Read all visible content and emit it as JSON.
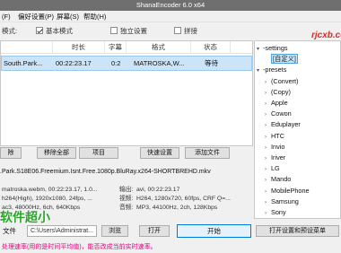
{
  "window": {
    "title": "ShanaEncoder 6.0 x64"
  },
  "menu": {
    "items": [
      "(F)",
      "偏好设置(P)",
      "屏幕(S)",
      "帮助(H)"
    ]
  },
  "options": {
    "mode_label": "模式:",
    "basic_mode": "基本模式",
    "independent": "独立设置",
    "concat": "拼接"
  },
  "filelist": {
    "columns": [
      "",
      "时长",
      "字幕",
      "格式",
      "状态"
    ],
    "rows": [
      {
        "name": "South.Park...",
        "duration": "00:22:23.17",
        "subtitle": "0:2",
        "format": "MATROSKA,W...",
        "status": "等待"
      }
    ]
  },
  "buttons": [
    "除",
    "移除全部",
    "项目",
    "快速设置",
    "添加文件"
  ],
  "details": {
    "path": ".Park.S18E06.Freemium.Isnt.Free.1080p.BluRay.x264-SHORTBREHD.mkv",
    "in1": "matroska.webm, 00:22:23.17, 1.0...",
    "in2": "h264(High), 1920x1080, 24fps, ...",
    "in3": "ac3, 48000Hz, 6ch, 640Kbps",
    "out1_label": "输出:",
    "out1": "avi, 00:22:23.17",
    "out2_label": "视频:",
    "out2": "H264, 1280x720, 60fps, CRF Q=...",
    "out3_label": "音频:",
    "out3": "MP3, 44100Hz, 2ch, 128Kbps"
  },
  "output": {
    "label": "文件",
    "path": "C:\\Users\\Administrat...",
    "browse": "浏览",
    "open": "打开",
    "start": "开始",
    "open_settings": "打开设置和预设菜单"
  },
  "status": "处理速率(用的是时间平均值)，能否改成当前实时速率。",
  "presets": {
    "nodes": [
      {
        "text": "-settings",
        "tw": "▾",
        "indent": 0
      },
      {
        "text": "[自定义]",
        "tw": "",
        "indent": 1,
        "selected": true
      },
      {
        "text": "-presets",
        "tw": "▾",
        "indent": 0
      },
      {
        "text": "(Convert)",
        "tw": "›",
        "indent": 1
      },
      {
        "text": "(Copy)",
        "tw": "›",
        "indent": 1
      },
      {
        "text": "Apple",
        "tw": "›",
        "indent": 1
      },
      {
        "text": "Cowon",
        "tw": "›",
        "indent": 1
      },
      {
        "text": "Eduplayer",
        "tw": "›",
        "indent": 1
      },
      {
        "text": "HTC",
        "tw": "›",
        "indent": 1
      },
      {
        "text": "Invio",
        "tw": "›",
        "indent": 1
      },
      {
        "text": "Iriver",
        "tw": "›",
        "indent": 1
      },
      {
        "text": "LG",
        "tw": "›",
        "indent": 1
      },
      {
        "text": "Mando",
        "tw": "›",
        "indent": 1
      },
      {
        "text": "MobilePhone",
        "tw": "›",
        "indent": 1
      },
      {
        "text": "Samsung",
        "tw": "›",
        "indent": 1
      },
      {
        "text": "Sony",
        "tw": "›",
        "indent": 1
      }
    ],
    "badge": "自定义"
  },
  "watermarks": {
    "site": "rjcxb.com",
    "overlay": "软件超小"
  }
}
